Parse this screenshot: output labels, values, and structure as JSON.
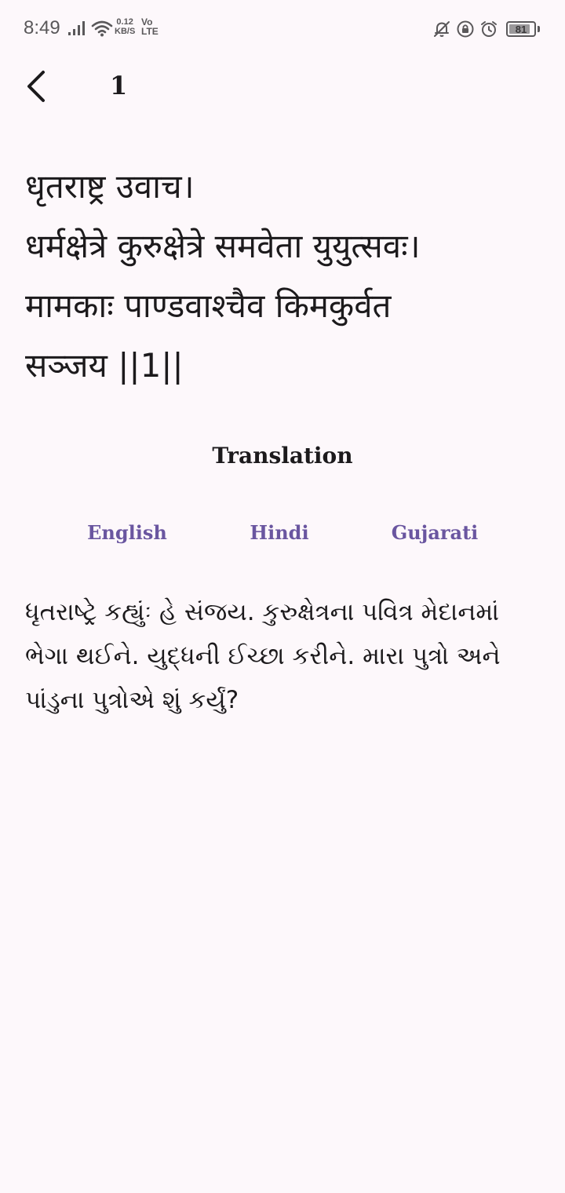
{
  "status_bar": {
    "time": "8:49",
    "speed_value": "0.12",
    "speed_unit": "KB/S",
    "volte_top": "Vo",
    "volte_bottom": "LTE",
    "battery_level": "81",
    "icons": [
      "signal-icon",
      "wifi-icon",
      "bell-off-icon",
      "lock-rotation-icon",
      "alarm-icon",
      "battery-icon"
    ]
  },
  "app_bar": {
    "back_icon": "back-arrow-icon",
    "title": "1"
  },
  "verse": {
    "lines": [
      "धृतराष्ट्र उवाच।",
      "धर्मक्षेत्रे कुरुक्षेत्रे समवेता युयुत्सवः।",
      "मामकाः पाण्डवाश्चैव किमकुर्वत",
      "सञ्जय ||1||"
    ]
  },
  "translation": {
    "heading": "Translation",
    "tabs": [
      "English",
      "Hindi",
      "Gujarati"
    ],
    "text": "ધૃતરાષ્ટ્રે કહ્યુંઃ હે સંજય. કુરુક્ષેત્રના પવિત્ર મેદાનમાં ભેગા થઈને. યુદ્ધની ઈચ્છા કરીને. મારા પુત્રો અને પાંડુના પુત્રોએ શું કર્યું?"
  },
  "colors": {
    "background": "#fdf8fb",
    "text": "#1c1a1c",
    "accent": "#6a56a0",
    "status": "#5a585a"
  }
}
